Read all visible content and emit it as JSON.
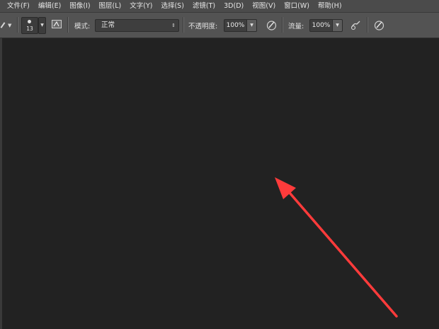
{
  "menu": [
    "文件(F)",
    "编辑(E)",
    "图像(I)",
    "图层(L)",
    "文字(Y)",
    "选择(S)",
    "滤镜(T)",
    "3D(D)",
    "视图(V)",
    "窗口(W)",
    "帮助(H)"
  ],
  "options": {
    "brush_size": "13",
    "mode_label": "模式:",
    "mode_value": "正常",
    "opacity_label": "不透明度:",
    "opacity_value": "100%",
    "flow_label": "流量:",
    "flow_value": "100%"
  },
  "icons": {
    "tool_preset": "brush-icon",
    "brush_panel": "brush-panel-icon",
    "opacity_pressure": "pressure-opacity-icon",
    "airbrush": "airbrush-icon",
    "size_pressure": "pressure-size-icon"
  },
  "colors": {
    "menubar": "#4b4b4b",
    "optionsbar": "#535353",
    "canvas": "#222222",
    "annotation_arrow": "#ff3b3b"
  }
}
